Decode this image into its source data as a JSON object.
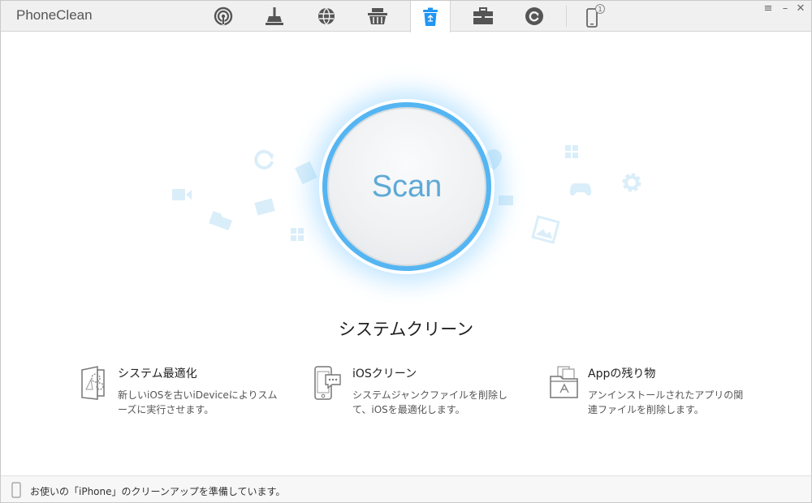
{
  "app": {
    "title": "PhoneClean"
  },
  "tabs": [
    {
      "id": "tab-quick-clean",
      "icon": "wifi-target-icon"
    },
    {
      "id": "tab-deep-clean",
      "icon": "broom-icon"
    },
    {
      "id": "tab-internet-clean",
      "icon": "globe-icon"
    },
    {
      "id": "tab-privacy-clean",
      "icon": "basket-icon"
    },
    {
      "id": "tab-system-clean",
      "icon": "recycle-bin-icon",
      "active": true
    },
    {
      "id": "tab-toolbox",
      "icon": "toolbox-icon"
    },
    {
      "id": "tab-silent-clean",
      "icon": "refresh-circle-icon"
    }
  ],
  "device": {
    "badge": "1"
  },
  "window_controls": {
    "menu": "≡",
    "minimize": "–",
    "close": "✕"
  },
  "scan": {
    "label": "Scan"
  },
  "section": {
    "title": "システムクリーン"
  },
  "features": [
    {
      "title": "システム最適化",
      "desc": "新しいiOSを古いiDeviceによりスムーズに実行させます。",
      "icon": "system-optimize-icon"
    },
    {
      "title": "iOSクリーン",
      "desc": "システムジャンクファイルを削除して、iOSを最適化します。",
      "icon": "ios-clean-icon"
    },
    {
      "title": "Appの残り物",
      "desc": "アンインストールされたアプリの関連ファイルを削除します。",
      "icon": "app-leftovers-icon"
    }
  ],
  "status": {
    "text": "お使いの「iPhone」のクリーンアップを準備しています。"
  },
  "colors": {
    "accent": "#41a9ec",
    "scan_text": "#5ea9d6",
    "icon_gray": "#555555",
    "active_icon": "#2196f3"
  }
}
